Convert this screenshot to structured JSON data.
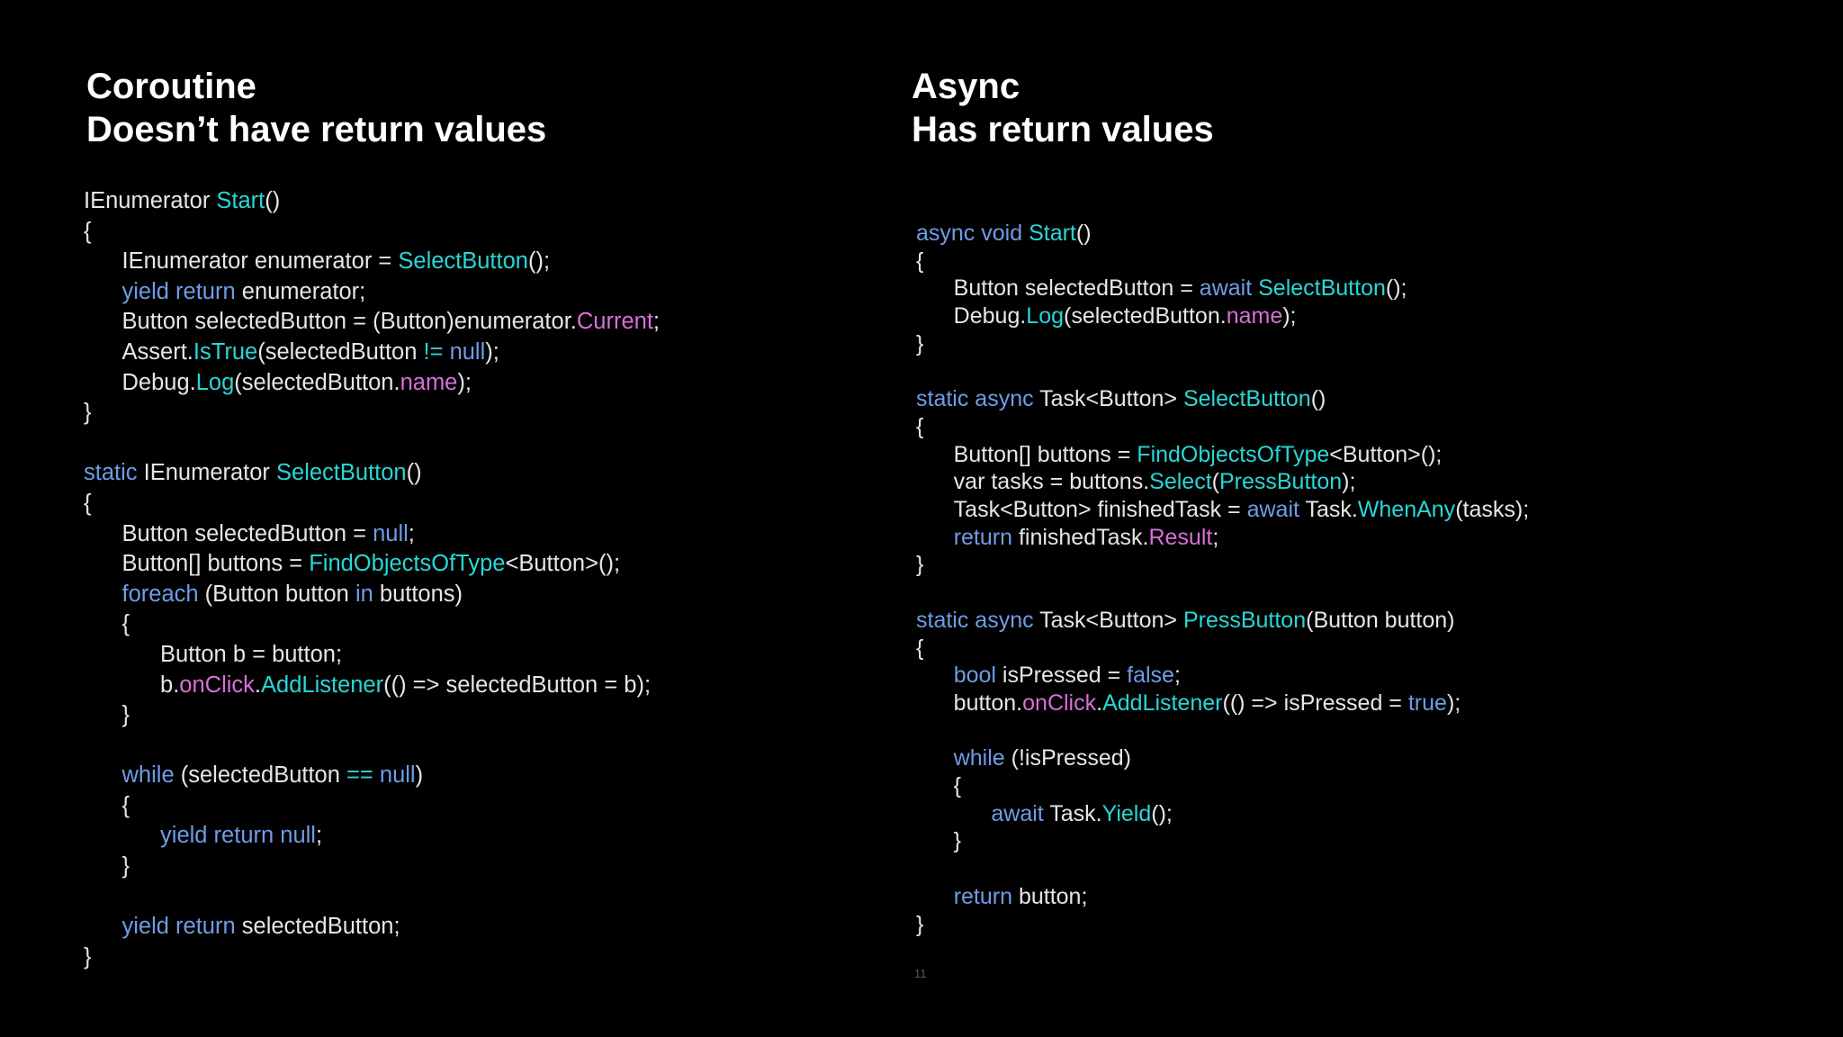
{
  "colors": {
    "background": "#000000",
    "plain": "#e6e6e6",
    "keyword": "#6f9ce6",
    "method": "#2ad6d6",
    "property": "#d86fd8"
  },
  "left": {
    "title": "Coroutine",
    "subtitle": "Doesn’t have return values",
    "code": [
      [
        [
          "IEnumerator ",
          "plain"
        ],
        [
          "Start",
          "method"
        ],
        [
          "()",
          "plain"
        ]
      ],
      [
        [
          "{",
          "plain"
        ]
      ],
      [
        [
          "\tIEnumerator enumerator = ",
          "plain"
        ],
        [
          "SelectButton",
          "method"
        ],
        [
          "();",
          "plain"
        ]
      ],
      [
        [
          "\t",
          "plain"
        ],
        [
          "yield return",
          "keyword"
        ],
        [
          " enumerator;",
          "plain"
        ]
      ],
      [
        [
          "\tButton selectedButton = (Button)enumerator.",
          "plain"
        ],
        [
          "Current",
          "property"
        ],
        [
          ";",
          "plain"
        ]
      ],
      [
        [
          "\tAssert.",
          "plain"
        ],
        [
          "IsTrue",
          "method"
        ],
        [
          "(selectedButton ",
          "plain"
        ],
        [
          "!=",
          "method"
        ],
        [
          " ",
          "plain"
        ],
        [
          "null",
          "keyword"
        ],
        [
          ");",
          "plain"
        ]
      ],
      [
        [
          "\tDebug.",
          "plain"
        ],
        [
          "Log",
          "method"
        ],
        [
          "(selectedButton.",
          "plain"
        ],
        [
          "name",
          "property"
        ],
        [
          ");",
          "plain"
        ]
      ],
      [
        [
          "}",
          "plain"
        ]
      ],
      [],
      [
        [
          "static",
          "keyword"
        ],
        [
          " IEnumerator ",
          "plain"
        ],
        [
          "SelectButton",
          "method"
        ],
        [
          "()",
          "plain"
        ]
      ],
      [
        [
          "{",
          "plain"
        ]
      ],
      [
        [
          "\tButton selectedButton = ",
          "plain"
        ],
        [
          "null",
          "keyword"
        ],
        [
          ";",
          "plain"
        ]
      ],
      [
        [
          "\tButton[] buttons = ",
          "plain"
        ],
        [
          "FindObjectsOfType",
          "method"
        ],
        [
          "<Button>();",
          "plain"
        ]
      ],
      [
        [
          "\t",
          "plain"
        ],
        [
          "foreach",
          "keyword"
        ],
        [
          " (Button button ",
          "plain"
        ],
        [
          "in",
          "keyword"
        ],
        [
          " buttons)",
          "plain"
        ]
      ],
      [
        [
          "\t{",
          "plain"
        ]
      ],
      [
        [
          "\t\tButton b = button;",
          "plain"
        ]
      ],
      [
        [
          "\t\tb.",
          "plain"
        ],
        [
          "onClick",
          "property"
        ],
        [
          ".",
          "plain"
        ],
        [
          "AddListener",
          "method"
        ],
        [
          "(() => selectedButton = b);",
          "plain"
        ]
      ],
      [
        [
          "\t}",
          "plain"
        ]
      ],
      [],
      [
        [
          "\t",
          "plain"
        ],
        [
          "while",
          "keyword"
        ],
        [
          " (selectedButton ",
          "plain"
        ],
        [
          "==",
          "method"
        ],
        [
          " ",
          "plain"
        ],
        [
          "null",
          "keyword"
        ],
        [
          ")",
          "plain"
        ]
      ],
      [
        [
          "\t{",
          "plain"
        ]
      ],
      [
        [
          "\t\t",
          "plain"
        ],
        [
          "yield return null",
          "keyword"
        ],
        [
          ";",
          "plain"
        ]
      ],
      [
        [
          "\t}",
          "plain"
        ]
      ],
      [],
      [
        [
          "\t",
          "plain"
        ],
        [
          "yield return",
          "keyword"
        ],
        [
          " selectedButton;",
          "plain"
        ]
      ],
      [
        [
          "}",
          "plain"
        ]
      ]
    ]
  },
  "right": {
    "title": "Async",
    "subtitle": "Has return values",
    "code": [
      [
        [
          "async void",
          "keyword"
        ],
        [
          " ",
          "plain"
        ],
        [
          "Start",
          "method"
        ],
        [
          "()",
          "plain"
        ]
      ],
      [
        [
          "{",
          "plain"
        ]
      ],
      [
        [
          "\tButton selectedButton = ",
          "plain"
        ],
        [
          "await",
          "keyword"
        ],
        [
          " ",
          "plain"
        ],
        [
          "SelectButton",
          "method"
        ],
        [
          "();",
          "plain"
        ]
      ],
      [
        [
          "\tDebug.",
          "plain"
        ],
        [
          "Log",
          "method"
        ],
        [
          "(selectedButton.",
          "plain"
        ],
        [
          "name",
          "property"
        ],
        [
          ");",
          "plain"
        ]
      ],
      [
        [
          "}",
          "plain"
        ]
      ],
      [],
      [
        [
          "static async",
          "keyword"
        ],
        [
          " Task<Button> ",
          "plain"
        ],
        [
          "SelectButton",
          "method"
        ],
        [
          "()",
          "plain"
        ]
      ],
      [
        [
          "{",
          "plain"
        ]
      ],
      [
        [
          "\tButton[] buttons = ",
          "plain"
        ],
        [
          "FindObjectsOfType",
          "method"
        ],
        [
          "<Button>();",
          "plain"
        ]
      ],
      [
        [
          "\tvar tasks = buttons.",
          "plain"
        ],
        [
          "Select",
          "method"
        ],
        [
          "(",
          "plain"
        ],
        [
          "PressButton",
          "method"
        ],
        [
          ");",
          "plain"
        ]
      ],
      [
        [
          "\tTask<Button> finishedTask = ",
          "plain"
        ],
        [
          "await",
          "keyword"
        ],
        [
          " Task.",
          "plain"
        ],
        [
          "WhenAny",
          "method"
        ],
        [
          "(tasks);",
          "plain"
        ]
      ],
      [
        [
          "\t",
          "plain"
        ],
        [
          "return",
          "keyword"
        ],
        [
          " finishedTask.",
          "plain"
        ],
        [
          "Result",
          "property"
        ],
        [
          ";",
          "plain"
        ]
      ],
      [
        [
          "}",
          "plain"
        ]
      ],
      [],
      [
        [
          "static async",
          "keyword"
        ],
        [
          " Task<Button> ",
          "plain"
        ],
        [
          "PressButton",
          "method"
        ],
        [
          "(Button button)",
          "plain"
        ]
      ],
      [
        [
          "{",
          "plain"
        ]
      ],
      [
        [
          "\t",
          "plain"
        ],
        [
          "bool",
          "keyword"
        ],
        [
          " isPressed = ",
          "plain"
        ],
        [
          "false",
          "keyword"
        ],
        [
          ";",
          "plain"
        ]
      ],
      [
        [
          "\tbutton.",
          "plain"
        ],
        [
          "onClick",
          "property"
        ],
        [
          ".",
          "plain"
        ],
        [
          "AddListener",
          "method"
        ],
        [
          "(() => isPressed = ",
          "plain"
        ],
        [
          "true",
          "keyword"
        ],
        [
          ");",
          "plain"
        ]
      ],
      [],
      [
        [
          "\t",
          "plain"
        ],
        [
          "while",
          "keyword"
        ],
        [
          " (!isPressed)",
          "plain"
        ]
      ],
      [
        [
          "\t{",
          "plain"
        ]
      ],
      [
        [
          "\t\t",
          "plain"
        ],
        [
          "await",
          "keyword"
        ],
        [
          " Task.",
          "plain"
        ],
        [
          "Yield",
          "method"
        ],
        [
          "();",
          "plain"
        ]
      ],
      [
        [
          "\t}",
          "plain"
        ]
      ],
      [],
      [
        [
          "\t",
          "plain"
        ],
        [
          "return",
          "keyword"
        ],
        [
          " button;",
          "plain"
        ]
      ],
      [
        [
          "}",
          "plain"
        ]
      ]
    ]
  },
  "page_number": "11"
}
